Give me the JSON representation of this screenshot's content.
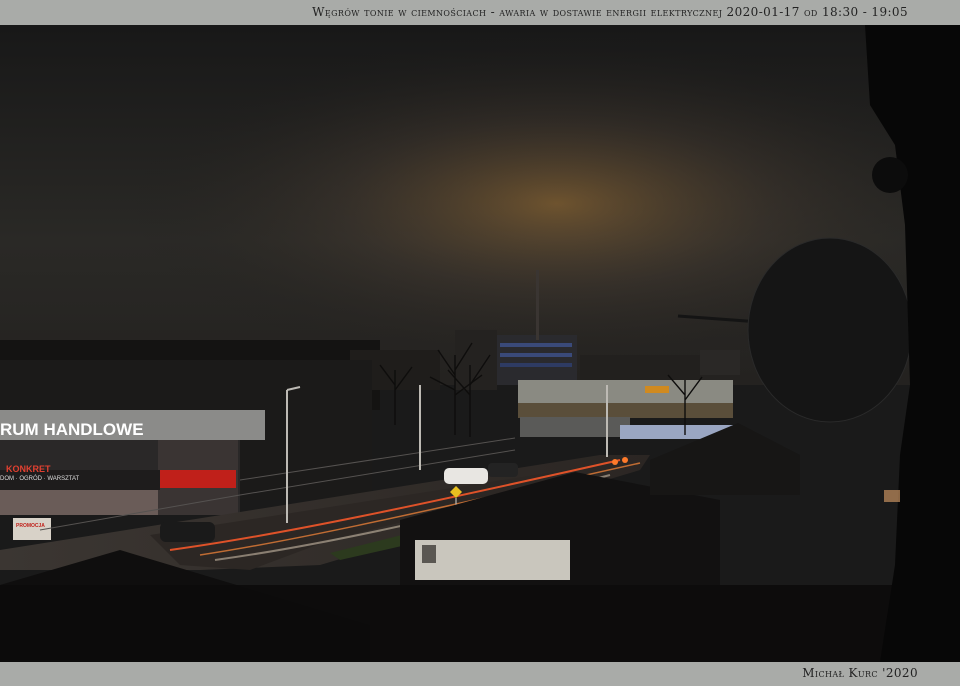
{
  "header": {
    "caption": "Węgrów tonie w ciemnościach - awaria w dostawie energii elektrycznej 2020-01-17 od 18:30 - 19:05"
  },
  "footer": {
    "credit": "Michał Kurc '2020"
  },
  "scene": {
    "signs": {
      "mall": "RUM HANDLOWE",
      "shop": "KONKRET",
      "shop_sub": "DOM · OGRÓD · WARSZTAT",
      "poster": "PROMOCJA"
    }
  },
  "colors": {
    "frame": "#a9aba8",
    "sky": "#1d1c1b",
    "glow": "#a87838",
    "accent_red": "#c0201a",
    "tail_light": "#ff5a2a"
  }
}
